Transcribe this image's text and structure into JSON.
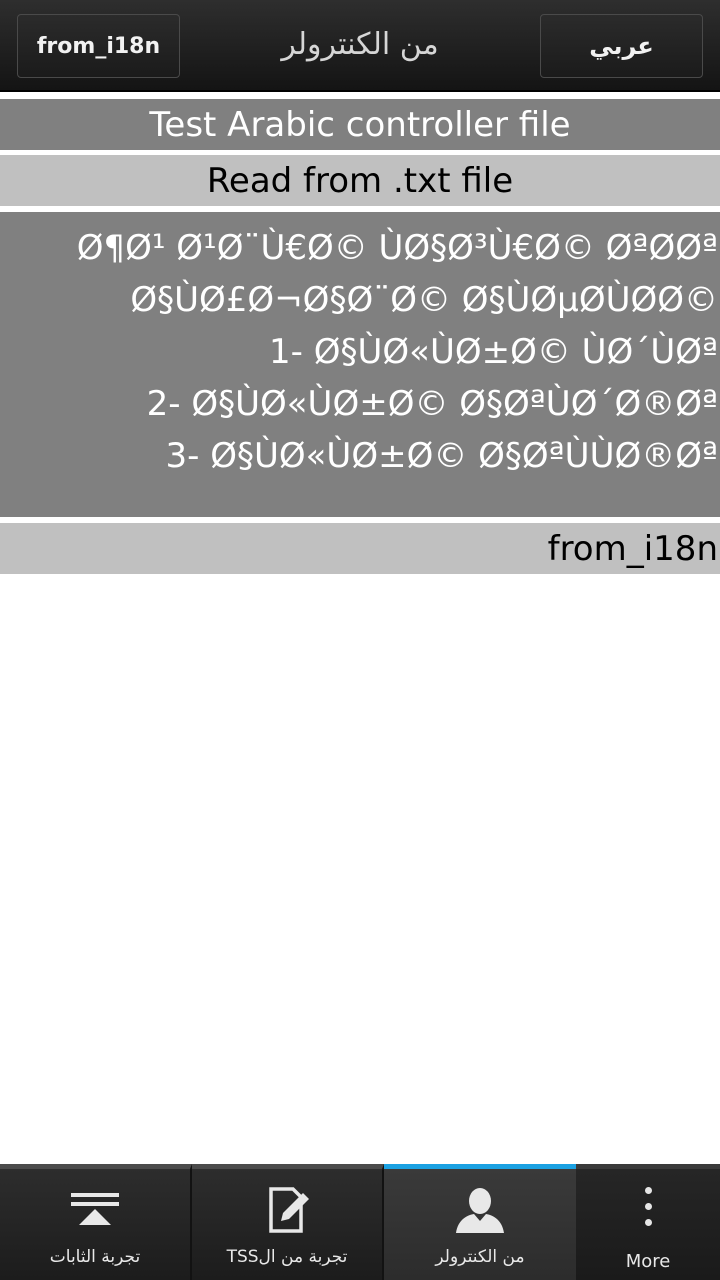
{
  "titlebar": {
    "left_button": "from_i18n",
    "title": "من الكنترولر",
    "right_button": "عربي"
  },
  "content": {
    "row1": "Test Arabic controller file",
    "row2": "Read from .txt file",
    "txt_lines": [
      "Ø¶Ø¹ Ø¹Ø¨Ù€Ø© ÙØ§Ø³Ù€Ø© ØªØØª",
      "Ø§ÙØ£Ø¬Ø§Ø¨Ø© Ø§ÙØµØÙØØ©",
      "1- Ø§ÙØ«ÙØ±Ø© ÙØ´ÙØª",
      "2- Ø§ÙØ«ÙØ±Ø© Ø§ØªÙØ´Ø®Øª",
      "3- Ø§ÙØ«ÙØ±Ø© Ø§ØªÙÙØ®Øª"
    ],
    "row4": "from_i18n"
  },
  "actionbar": {
    "tabs": [
      {
        "label": "تجربة الثابات",
        "icon": "collapse-icon"
      },
      {
        "label": "تجربة من الTSS",
        "icon": "edit-note-icon"
      },
      {
        "label": "من الكنترولر",
        "icon": "person-icon"
      }
    ],
    "more_label": "More",
    "active_color": "#1ba1e2"
  }
}
